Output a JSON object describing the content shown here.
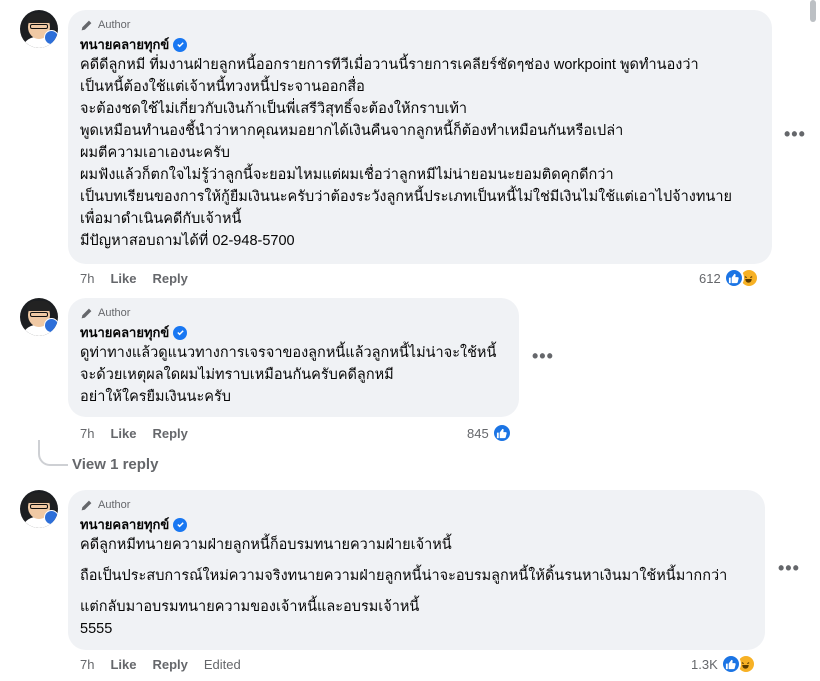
{
  "comments": [
    {
      "author_badge": "Author",
      "name": "ทนายคลายทุกข์",
      "lines": [
        "คดีดีลูกหมี ที่มงานฝ่ายลูกหนี้ออกรายการทีวีเมื่อวานนี้รายการเคลียร์ชัดๆช่อง workpoint พูดทำนองว่า",
        "เป็นหนี้ต้องใช้แต่เจ้าหนี้ทวงหนี้ประจานออกสื่อ",
        "จะต้องชดใช้ไม่เกี่ยวกับเงินก้าเป็นพี่เสรีวิสุทธิ์จะต้องให้กราบเท้า",
        "พูดเหมือนทำนองชี้นำว่าหากคุณหมอยากได้เงินคืนจากลูกหนี้ก็ต้องทำเหมือนกันหรือเปล่า",
        "ผมตีความเอาเองนะครับ",
        "ผมฟังแล้วก็ตกใจไม่รู้ว่าลูกนี้จะยอมไหมแต่ผมเชื่อว่าลูกหมีไม่น่ายอมนะยอมติดคุกดีกว่า",
        "เป็นบทเรียนของการให้กู้ยืมเงินนะครับว่าต้องระวังลูกหนี้ประเภทเป็นหนี้ไม่ใช่มีเงินไม่ใช้แต่เอาไปจ้างทนาย",
        "เพื่อมาดำเนินคดีกับเจ้าหนี้",
        "มีปัญหาสอบถามได้ที่ 02-948-5700"
      ],
      "time": "7h",
      "like": "Like",
      "reply": "Reply",
      "reactions": "612"
    },
    {
      "author_badge": "Author",
      "name": "ทนายคลายทุกข์",
      "lines": [
        "ดูท่าทางแล้วดูแนวทางการเจรจาของลูกหนี้แล้วลูกหนี้ไม่น่าจะใช้หนี้",
        "จะด้วยเหตุผลใดผมไม่ทราบเหมือนกันครับคดีลูกหมี",
        "อย่าให้ใครยืมเงินนะครับ"
      ],
      "time": "7h",
      "like": "Like",
      "reply": "Reply",
      "reactions": "845",
      "view_replies": "View 1 reply"
    },
    {
      "author_badge": "Author",
      "name": "ทนายคลายทุกข์",
      "lines": [
        "คดีลูกหมีทนายความฝ่ายลูกหนี้ก็อบรมทนายความฝ่ายเจ้าหนี้",
        "ถือเป็นประสบการณ์ใหม่ความจริงทนายความฝ่ายลูกหนี้น่าจะอบรมลูกหนี้ให้ดิ้นรนหาเงินมาใช้หนี้มากกว่า",
        "แต่กลับมาอบรมทนายความของเจ้าหนี้และอบรมเจ้าหนี้",
        "5555"
      ],
      "time": "7h",
      "like": "Like",
      "reply": "Reply",
      "edited": "Edited",
      "reactions": "1.3K"
    }
  ],
  "colors": {
    "bubble": "#f0f2f5",
    "verified": "#1877f2",
    "like_reaction": "#1b74e4",
    "haha_reaction": "#f7b125",
    "meta_text": "#65676b"
  },
  "icons": [
    "pencil-icon",
    "verified-icon",
    "like-reaction-icon",
    "haha-reaction-icon",
    "more-options-icon"
  ]
}
